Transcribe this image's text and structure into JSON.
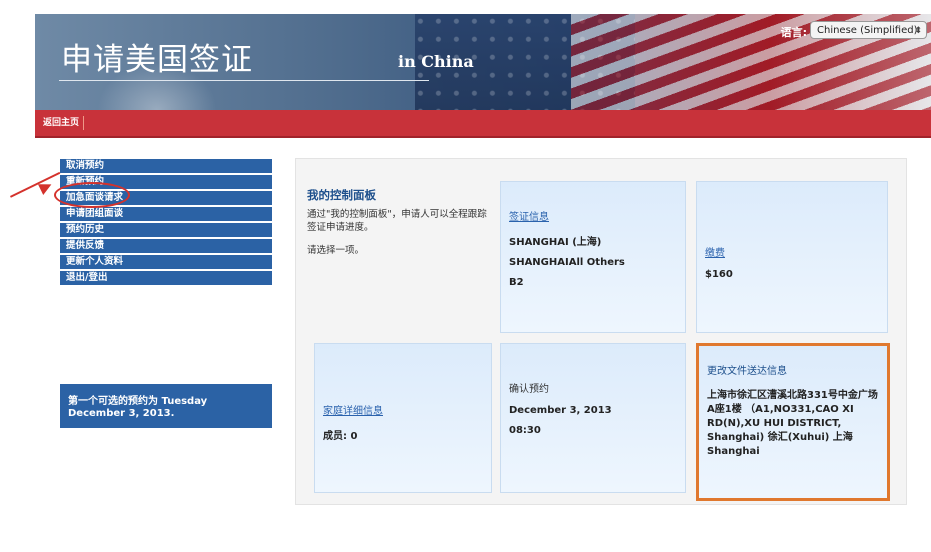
{
  "header": {
    "site_title": "申请美国签证",
    "site_subtitle": "in China",
    "language_label": "语言:",
    "language_value": "Chinese (Simplified)",
    "language_arrows": "⬍"
  },
  "navbar": {
    "home_label": "返回主页"
  },
  "sidebar": {
    "items": [
      {
        "label": "取消预约"
      },
      {
        "label": "重新预约"
      },
      {
        "label": "加急面谈请求"
      },
      {
        "label": "申请团组面谈"
      },
      {
        "label": "预约历史"
      },
      {
        "label": "提供反馈"
      },
      {
        "label": "更新个人资料"
      },
      {
        "label": "退出/登出"
      }
    ],
    "notice": "第一个可选的预约为 Tuesday December 3, 2013."
  },
  "dashboard": {
    "title": "我的控制面板",
    "description": "通过\"我的控制面板\"，申请人可以全程跟踪签证申请进度。",
    "prompt": "请选择一项。",
    "visa_info": {
      "link": "签证信息",
      "location": "SHANGHAI (上海)",
      "post": "SHANGHAIAll Others",
      "visa_class": "B2"
    },
    "fee": {
      "link": "缴费",
      "amount": "$160"
    },
    "family": {
      "link": "家庭详细信息",
      "members_label": "成员:",
      "members_count": "0"
    },
    "confirm": {
      "label": "确认预约",
      "date": "December 3, 2013",
      "time": "08:30"
    },
    "delivery": {
      "label": "更改文件送达信息",
      "address": "上海市徐汇区漕溪北路331号中金广场A座1楼 （A1,NO331,CAO XI RD(N),XU HUI DISTRICT, Shanghai) 徐汇(Xuhui) 上海 Shanghai"
    }
  },
  "colors": {
    "nav_red": "#c8323a",
    "sidebar_blue": "#2b62a5",
    "link_blue": "#2a62ad",
    "highlight_orange": "#e0782e",
    "annotation_red": "#d4322c"
  }
}
